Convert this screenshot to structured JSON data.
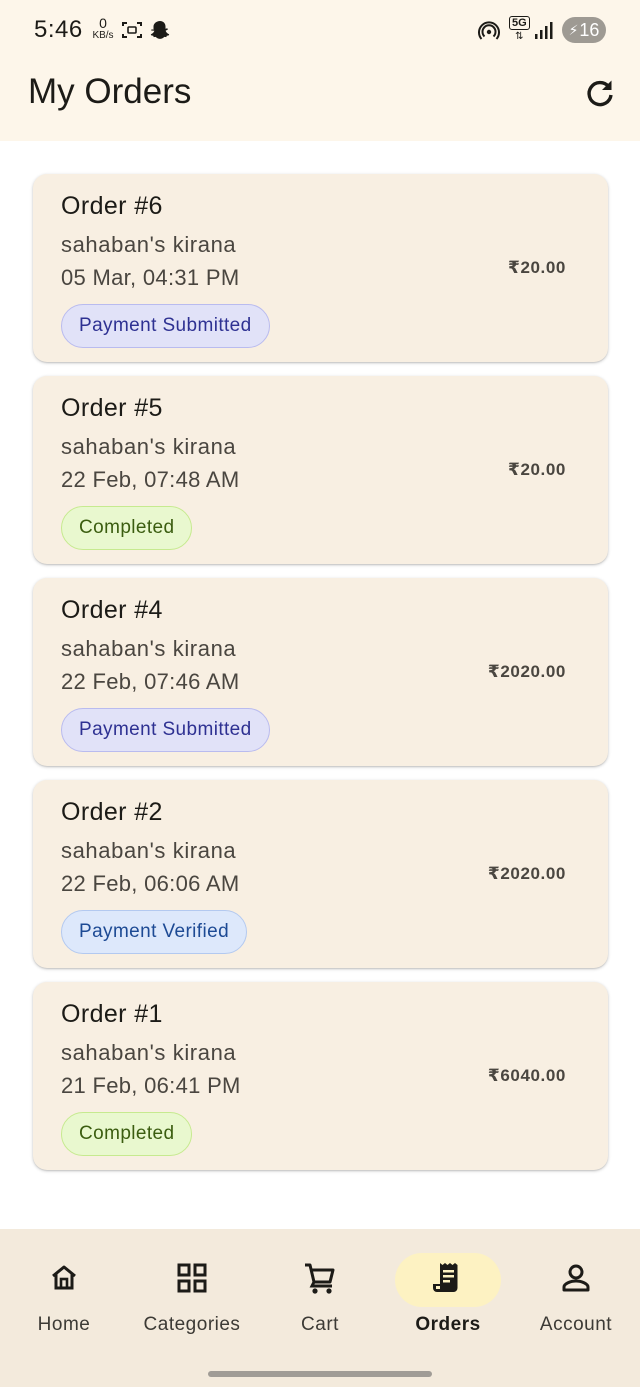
{
  "status_bar": {
    "time": "5:46",
    "net_speed_value": "0",
    "net_speed_unit": "KB/s",
    "network_label": "5G",
    "battery_level": "16"
  },
  "header": {
    "title": "My Orders",
    "refresh_icon": "refresh-icon"
  },
  "orders": [
    {
      "title": "Order #6",
      "store": "sahaban's  kirana",
      "date": "05 Mar, 04:31 PM",
      "amount": "₹20.00",
      "status": "Payment Submitted"
    },
    {
      "title": "Order #5",
      "store": "sahaban's  kirana",
      "date": "22 Feb, 07:48 AM",
      "amount": "₹20.00",
      "status": "Completed"
    },
    {
      "title": "Order #4",
      "store": "sahaban's  kirana",
      "date": "22 Feb, 07:46 AM",
      "amount": "₹2020.00",
      "status": "Payment Submitted"
    },
    {
      "title": "Order #2",
      "store": "sahaban's  kirana",
      "date": "22 Feb, 06:06 AM",
      "amount": "₹2020.00",
      "status": "Payment Verified"
    },
    {
      "title": "Order #1",
      "store": "sahaban's  kirana",
      "date": "21 Feb, 06:41 PM",
      "amount": "₹6040.00",
      "status": "Completed"
    }
  ],
  "status_colors": {
    "Payment Submitted": "#e1e2f8",
    "Completed": "#e9f8cf",
    "Payment Verified": "#dde8fb"
  },
  "bottom_nav": {
    "items": [
      {
        "label": "Home",
        "icon": "home-icon",
        "active": false
      },
      {
        "label": "Categories",
        "icon": "grid-icon",
        "active": false
      },
      {
        "label": "Cart",
        "icon": "cart-icon",
        "active": false
      },
      {
        "label": "Orders",
        "icon": "receipt-icon",
        "active": true
      },
      {
        "label": "Account",
        "icon": "person-icon",
        "active": false
      }
    ]
  },
  "colors": {
    "header_bg": "#fdf6ea",
    "card_bg": "#f8efe2",
    "nav_bg": "#f3eadc",
    "active_pill": "#fdf2c2"
  }
}
